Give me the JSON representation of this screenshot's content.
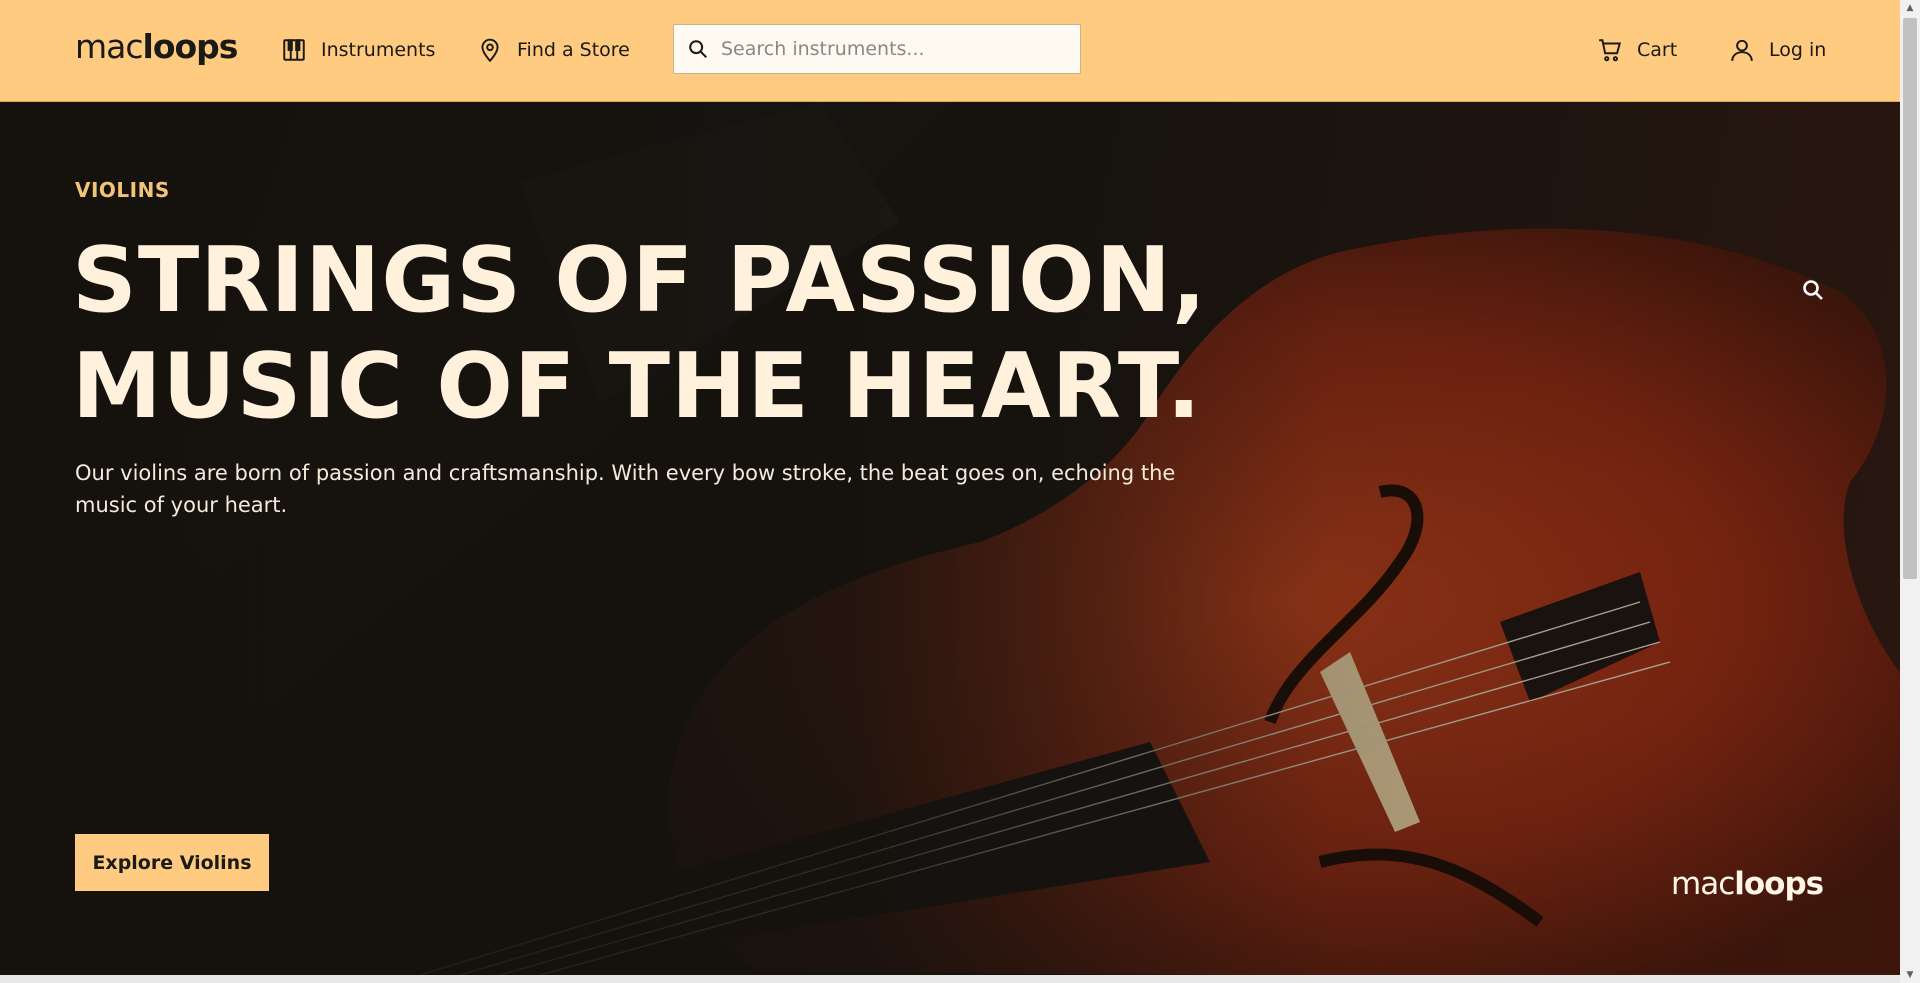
{
  "header": {
    "logo": {
      "light": "mac",
      "bold": "loops"
    },
    "nav": [
      {
        "label": "Instruments",
        "icon": "piano-keys-icon"
      },
      {
        "label": "Find a Store",
        "icon": "map-pin-icon"
      }
    ],
    "search": {
      "placeholder": "Search instruments...",
      "value": "",
      "icon": "search-icon"
    },
    "cart_label": "Cart",
    "login_label": "Log in"
  },
  "hero": {
    "tag": "VIOLINS",
    "headline_line1": "STRINGS OF PASSION,",
    "headline_line2": "MUSIC OF THE HEART.",
    "subtitle": "Our violins are born of passion and craftsmanship. With every bow stroke, the beat goes on, echoing the music of your heart.",
    "cta_label": "Explore Violins",
    "watermark": {
      "light": "mac",
      "bold": "loops"
    }
  },
  "colors": {
    "header_bg": "#ffcb80",
    "accent": "#f2c477",
    "headline": "#fff1dc",
    "violin": "#8a2a12"
  }
}
